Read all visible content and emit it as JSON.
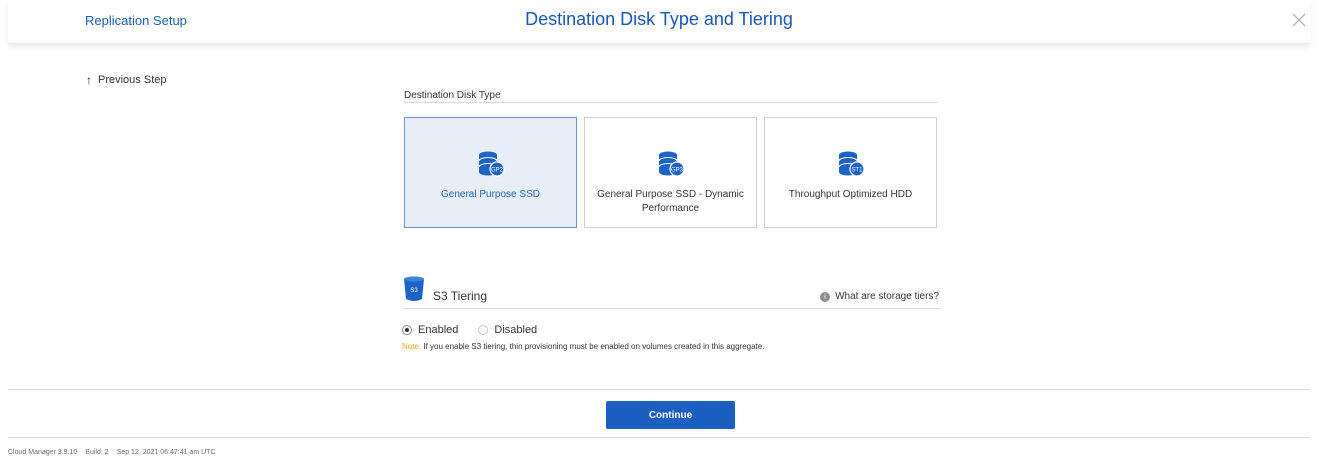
{
  "header": {
    "breadcrumb": "Replication Setup",
    "title": "Destination Disk Type and Tiering"
  },
  "nav": {
    "previous_step": "Previous Step"
  },
  "disk_type": {
    "section_label": "Destination Disk Type",
    "options": [
      {
        "badge": "GP2",
        "label": "General Purpose SSD",
        "selected": true
      },
      {
        "badge": "GP3",
        "label": "General Purpose SSD - Dynamic Performance",
        "selected": false
      },
      {
        "badge": "ST1",
        "label": "Throughput Optimized HDD",
        "selected": false
      }
    ]
  },
  "tiering": {
    "icon_label": "S3",
    "title": "S3 Tiering",
    "help_link": "What are storage tiers?",
    "help_icon": "i",
    "options": [
      {
        "label": "Enabled",
        "checked": true
      },
      {
        "label": "Disabled",
        "checked": false
      }
    ],
    "note_key": "Note:",
    "note_text": " If you enable S3 tiering, thin provisioning must be enabled on volumes created in this aggregate."
  },
  "actions": {
    "continue_label": "Continue"
  },
  "footer": {
    "app_version": "Cloud Manager 3.9.10",
    "build": "Build: 2",
    "timestamp": "Sep 12, 2021 06:47:41 am UTC"
  },
  "colors": {
    "brand_blue": "#1b5fc1",
    "selected_bg": "#e7eef8",
    "note_accent": "#e1a51b",
    "disk_icon": "#1b63c6"
  }
}
